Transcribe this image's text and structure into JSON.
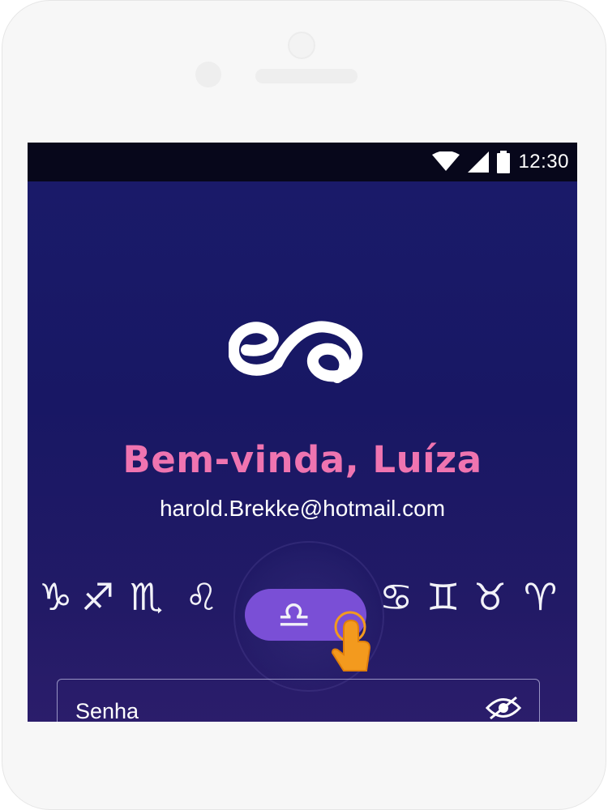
{
  "status_bar": {
    "time": "12:30",
    "icons": [
      "wifi-icon",
      "cellular-signal-icon",
      "battery-icon"
    ]
  },
  "logo": {
    "icon": "brand-logo-icon"
  },
  "welcome": {
    "title": "Bem-vinda, Luíza",
    "email": "harold.Brekke@hotmail.com"
  },
  "zodiac": {
    "signs": [
      "♑",
      "♐",
      "♏",
      "♌",
      "♎",
      "♋",
      "♊",
      "♉",
      "♈"
    ],
    "selected": "♎"
  },
  "password": {
    "label": "Senha",
    "visibility_icon": "eye-off-icon"
  },
  "colors": {
    "accent_pink": "#ef74b0",
    "selected_pill": "#7a4fd6",
    "hand_orange": "#f39a1e",
    "background_navy": "#1a1b6a"
  }
}
